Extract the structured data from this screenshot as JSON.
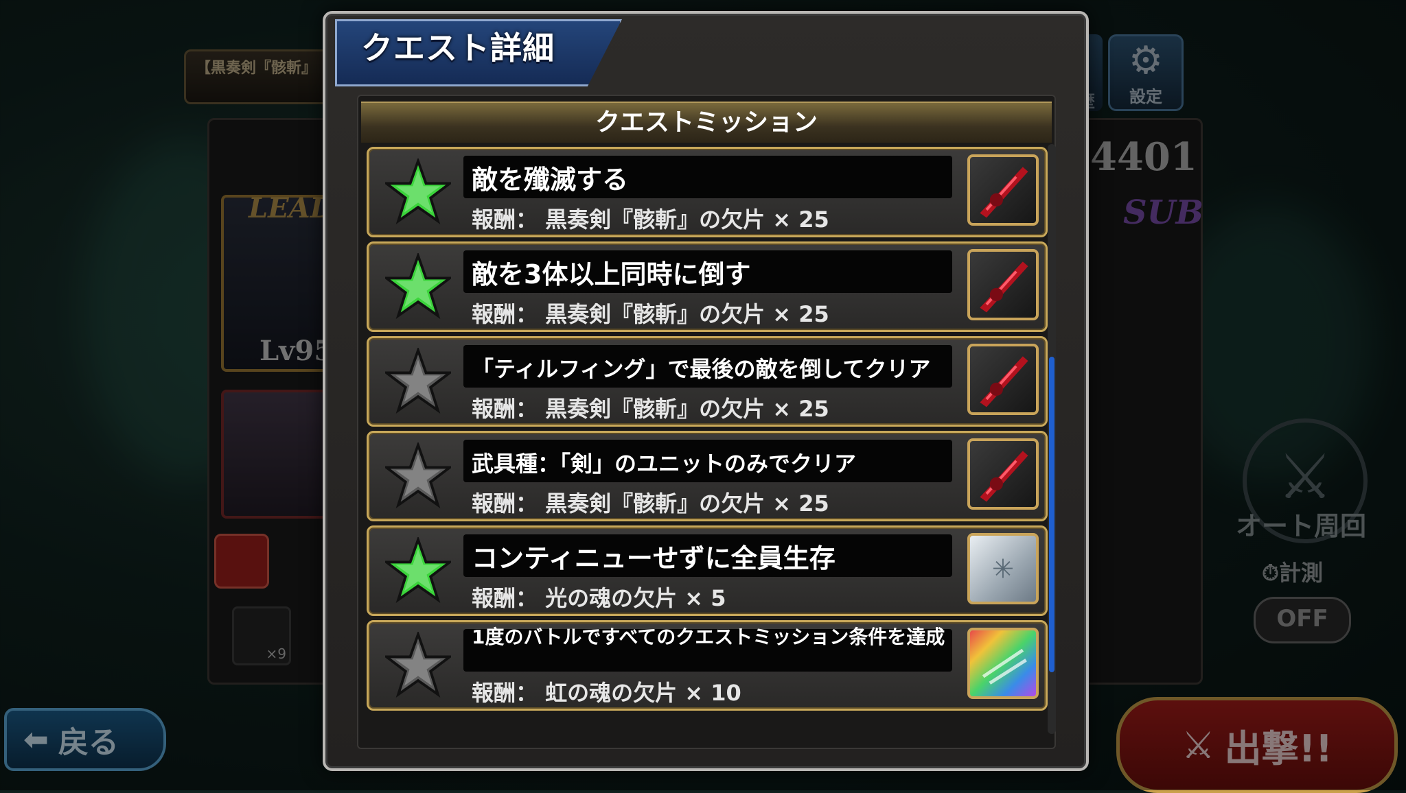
{
  "background": {
    "quest_banner": "【黒奏剣『骸斬』",
    "leader_tag": "LEAD",
    "leader_level": "Lv95",
    "power_number": "4401",
    "sub_tag": "SUB",
    "settings_label": "設定",
    "history_label": "歴",
    "auto_loop_label": "オート周回",
    "measure_label": "計測",
    "toggle_value": "OFF",
    "back_label": "戻る",
    "sortie_label": "出撃!!",
    "item_count": "×9"
  },
  "modal": {
    "title": "クエスト詳細",
    "section_title": "クエストミッション",
    "missions": [
      {
        "title": "敵を殲滅する",
        "reward": "報酬： 黒奏剣『骸斬』の欠片 × 25",
        "achieved": true,
        "reward_icon": "black-sword-shard-icon"
      },
      {
        "title": "敵を3体以上同時に倒す",
        "reward": "報酬： 黒奏剣『骸斬』の欠片 × 25",
        "achieved": true,
        "reward_icon": "black-sword-shard-icon"
      },
      {
        "title": "「ティルフィング」で最後の敵を倒してクリア",
        "reward": "報酬： 黒奏剣『骸斬』の欠片 × 25",
        "achieved": false,
        "reward_icon": "black-sword-shard-icon"
      },
      {
        "title": "武具種：「剣」のユニットのみでクリア",
        "reward": "報酬： 黒奏剣『骸斬』の欠片 × 25",
        "achieved": false,
        "reward_icon": "black-sword-shard-icon"
      },
      {
        "title": "コンティニューせずに全員生存",
        "reward": "報酬： 光の魂の欠片 × 5",
        "achieved": true,
        "reward_icon": "light-soul-shard-icon"
      },
      {
        "title": "1度のバトルですべてのクエストミッション条件を達成",
        "reward": "報酬： 虹の魂の欠片 × 10",
        "achieved": false,
        "reward_icon": "rainbow-soul-shard-icon"
      }
    ]
  },
  "colors": {
    "star_achieved": "#3bd43b",
    "star_unachieved": "#5a5a5a",
    "frame_gold": "#c8a85a",
    "title_blue": "#1b3566",
    "scroll_thumb": "#1f5fcf"
  }
}
